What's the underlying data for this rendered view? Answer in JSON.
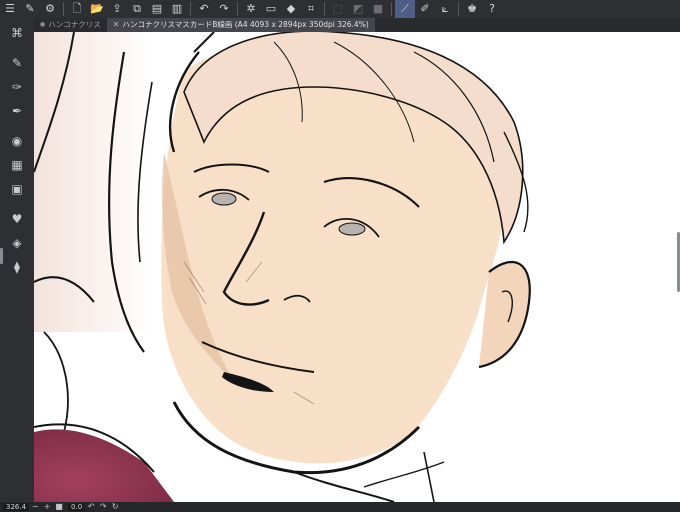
{
  "toolbar": {
    "items": [
      {
        "name": "menu-icon",
        "glyph": "☰"
      },
      {
        "name": "pen-settings-icon",
        "glyph": "✎"
      },
      {
        "name": "app-settings-icon",
        "glyph": "⚙"
      },
      {
        "name": "new-file-icon",
        "glyph": "🗋"
      },
      {
        "name": "open-file-icon",
        "glyph": "📂"
      },
      {
        "name": "save-cloud-icon",
        "glyph": "⇪"
      },
      {
        "name": "layer-copy-icon",
        "glyph": "⧉"
      },
      {
        "name": "layer-stack-icon",
        "glyph": "▤"
      },
      {
        "name": "layer-merge-icon",
        "glyph": "▥"
      },
      {
        "name": "undo-icon",
        "glyph": "↶"
      },
      {
        "name": "redo-icon",
        "glyph": "↷"
      },
      {
        "name": "spinner-icon",
        "glyph": "✲"
      },
      {
        "name": "clear-icon",
        "glyph": "▭"
      },
      {
        "name": "fill-icon",
        "glyph": "◆"
      },
      {
        "name": "transform-icon",
        "glyph": "⌗"
      },
      {
        "name": "selection-icon",
        "glyph": "⬚"
      },
      {
        "name": "mask-icon",
        "glyph": "◩"
      },
      {
        "name": "fill-selection-icon",
        "glyph": "■"
      },
      {
        "name": "ruler-snap-icon",
        "glyph": "⟋"
      },
      {
        "name": "brush-snap-icon",
        "glyph": "✐"
      },
      {
        "name": "line-snap-icon",
        "glyph": "⟀"
      },
      {
        "name": "quick-access-icon",
        "glyph": "♚"
      },
      {
        "name": "help-icon",
        "glyph": "?"
      }
    ]
  },
  "tabs": [
    {
      "label": "ハンコナクリス",
      "active": false
    },
    {
      "label": "ハンコナクリスマスカードB線画 (A4 4093 x 2894px 350dpi 326.4%)",
      "active": true
    }
  ],
  "leftbar": {
    "items": [
      {
        "name": "command-bar-icon",
        "glyph": "⌘"
      },
      {
        "name": "tool-icon",
        "glyph": "✎"
      },
      {
        "name": "sub-tool-icon",
        "glyph": "✑"
      },
      {
        "name": "tool-property-icon",
        "glyph": "✒"
      },
      {
        "name": "color-wheel-icon",
        "glyph": "◉"
      },
      {
        "name": "color-set-icon",
        "glyph": "▦"
      },
      {
        "name": "intermediate-color-icon",
        "glyph": "▣"
      },
      {
        "name": "layer-property-icon",
        "glyph": "♥"
      },
      {
        "name": "layer-icon",
        "glyph": "◈"
      },
      {
        "name": "material-icon",
        "glyph": "⧫"
      }
    ]
  },
  "status": {
    "zoom_value": "326.4",
    "minus": "−",
    "plus": "+",
    "fit": "■",
    "angle_value": "0.0",
    "rotate_left": "↶",
    "rotate_right": "↷",
    "reset": "↻"
  },
  "colors": {
    "ui_dark": "#2e2f33",
    "accent": "#4d5f86",
    "skin": "#f8e0c8",
    "ink": "#141414",
    "cloth": "#9b3d57"
  }
}
